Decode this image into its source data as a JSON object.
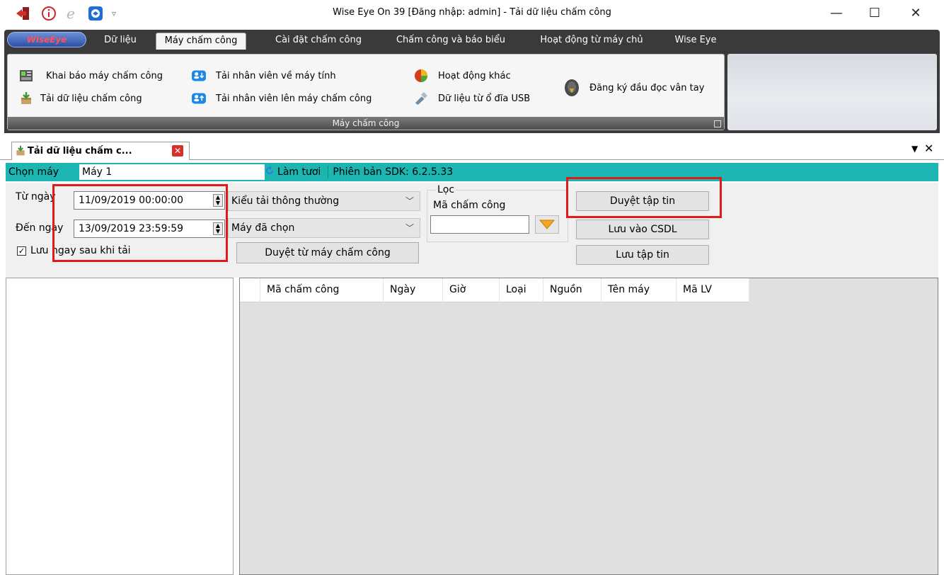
{
  "window": {
    "title": "Wise Eye On 39 [Đăng nhập: admin] - Tải dữ liệu chấm công",
    "minimize_glyph": "—",
    "maximize_glyph": "☐",
    "close_glyph": "✕"
  },
  "quick_access": {
    "dropdown_glyph": "▿"
  },
  "ribbon": {
    "logo_text": "WiseEye",
    "tabs": [
      {
        "label": "Dữ liệu"
      },
      {
        "label": "Máy chấm công"
      },
      {
        "label": "Cài đặt chấm công"
      },
      {
        "label": "Chấm công và báo biểu"
      },
      {
        "label": "Hoạt động từ máy chủ"
      },
      {
        "label": "Wise Eye"
      }
    ],
    "active_tab": "Máy chấm công",
    "group_caption": "Máy chấm công",
    "items": [
      {
        "label": "Khai báo máy chấm công",
        "icon": "terminal-icon"
      },
      {
        "label": "Tải dữ liệu chấm công",
        "icon": "box-download-icon"
      },
      {
        "label": "Tải nhân viên về máy tính",
        "icon": "users-download-icon"
      },
      {
        "label": "Tải nhân viên lên máy chấm công",
        "icon": "users-upload-icon"
      },
      {
        "label": "Hoạt động khác",
        "icon": "pie-icon"
      },
      {
        "label": "Dữ liệu từ ổ đĩa USB",
        "icon": "usb-icon"
      },
      {
        "label": "Đăng ký đầu đọc vân tay",
        "icon": "fingerprint-icon"
      }
    ]
  },
  "doc_tab": {
    "label": "Tải dữ liệu chấm c...",
    "close_glyph": "✕",
    "pin_glyph": "▼",
    "panel_close_glyph": "✕"
  },
  "machine_bar": {
    "label": "Chọn máy",
    "selected": "Máy 1",
    "dropdown_glyph": "▾",
    "refresh_label": "Làm tươi",
    "sdk_version": "Phiên bản SDK: 6.2.5.33"
  },
  "form": {
    "from_label": "Từ ngày",
    "from_value": "11/09/2019 00:00:00",
    "to_label": "Đến ngày",
    "to_value": "13/09/2019 23:59:59",
    "save_after_label": "Lưu ngay sau khi tải",
    "save_after_checked": true,
    "download_type": "Kiểu tải thông thường",
    "machine_scope": "Máy đã chọn",
    "browse_machine_button": "Duyệt từ máy chấm công",
    "filter_group": "Lọc",
    "filter_code_label": "Mã chấm công",
    "filter_code_value": "",
    "browse_file_button": "Duyệt tập tin",
    "save_db_button": "Lưu vào CSDL",
    "save_file_button": "Lưu tập tin"
  },
  "grid": {
    "columns": [
      "Mã chấm công",
      "Ngày",
      "Giờ",
      "Loại",
      "Nguồn",
      "Tên máy",
      "Mã LV"
    ]
  },
  "colors": {
    "ribbon_dark": "#3a3a3a",
    "machine_bar": "#1cb5b2",
    "highlight": "#e01b1b"
  }
}
